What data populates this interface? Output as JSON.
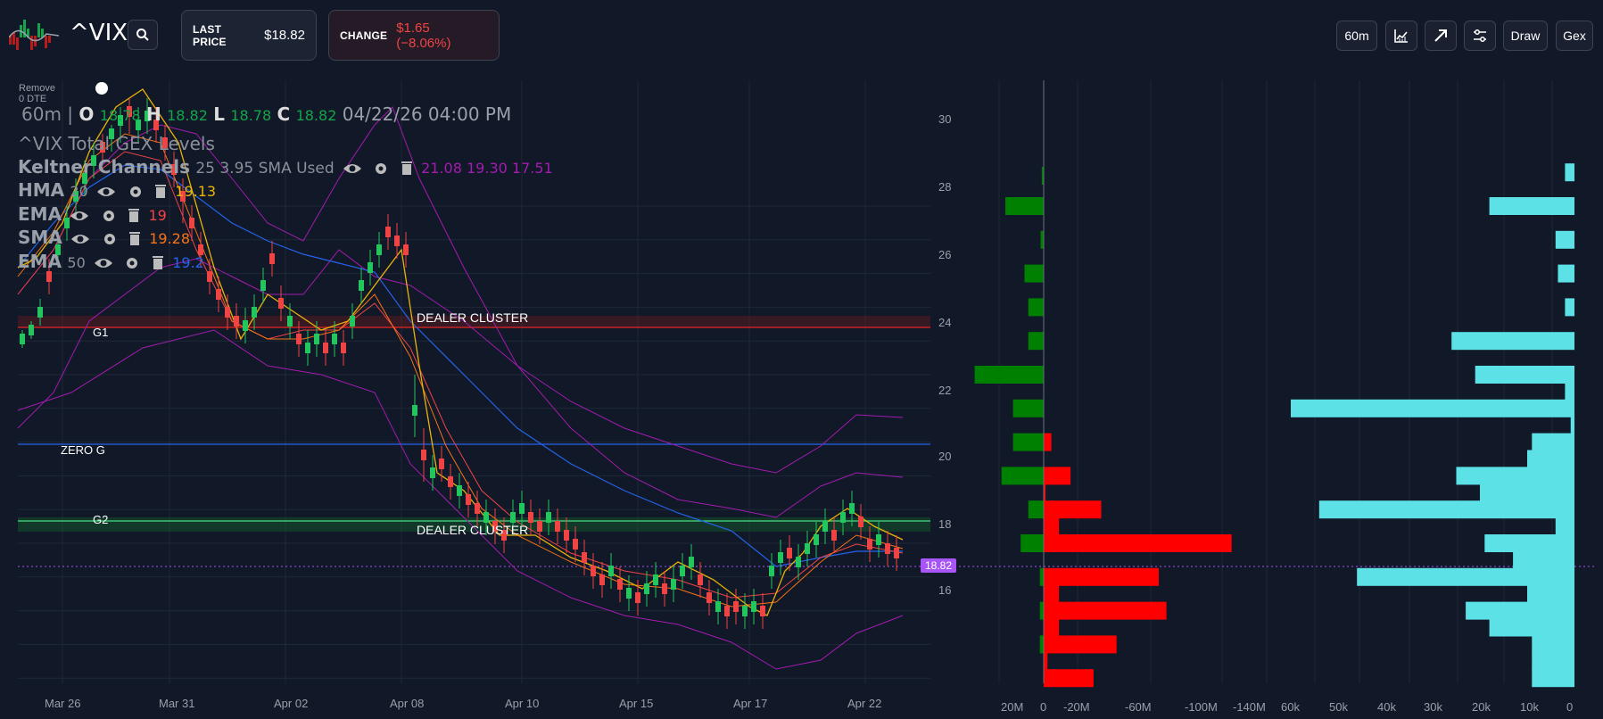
{
  "header": {
    "ticker": "^VIX",
    "last_price_label": "LAST PRICE",
    "last_price_value": "$18.82",
    "change_label": "CHANGE",
    "change_value": "$1.65 (−8.06%)",
    "toolbar": {
      "interval_label": "60m",
      "draw_label": "Draw",
      "gex_label": "Gex"
    }
  },
  "legend": {
    "remove_dte_label": "Remove 0 DTE",
    "ohlc": {
      "interval": "60m",
      "sep": "|",
      "o_label": "O",
      "o_value": "18.78",
      "h_label": "H",
      "h_value": "18.82",
      "l_label": "L",
      "l_value": "18.78",
      "c_label": "C",
      "c_value": "18.82",
      "timestamp": "04/22/26 04:00 PM"
    },
    "gex_title": "^VIX Total GEX Levels",
    "keltner": {
      "name": "Keltner Channels",
      "params": "25 3.95 SMA Used",
      "values": "21.08 19.30 17.51"
    },
    "hma": {
      "name": "HMA",
      "param": "20",
      "value": "19.13"
    },
    "ema1": {
      "name": "EMA",
      "param": "",
      "value": "19"
    },
    "sma": {
      "name": "SMA",
      "param": "",
      "value": "19.28"
    },
    "ema2": {
      "name": "EMA",
      "param": "50",
      "value": "19.2"
    }
  },
  "levels": {
    "g1": "G1",
    "zero_g": "ZERO G",
    "g2": "G2",
    "dealer_cluster_1": "DEALER CLUSTER",
    "dealer_cluster_2": "DEALER CLUSTER"
  },
  "price_tag": "18.82",
  "y_axis": [
    "30",
    "28",
    "26",
    "24",
    "22",
    "20",
    "18",
    "16"
  ],
  "x_axis": [
    "Mar 26",
    "Mar 31",
    "Apr 02",
    "Apr 08",
    "Apr 10",
    "Apr 15",
    "Apr 17",
    "Apr 22"
  ],
  "gex_axis": [
    "20M",
    "0",
    "-20M",
    "-60M",
    "-100M",
    "-140M"
  ],
  "oi_axis": [
    "60k",
    "50k",
    "40k",
    "30k",
    "20k",
    "10k",
    "0"
  ],
  "colors": {
    "bg": "#111827",
    "up": "#22c55e",
    "down": "#ef4444",
    "hma": "#eab308",
    "ema20": "#ef4444",
    "sma": "#f97316",
    "ema50": "#2563eb",
    "keltner": "#a21caf",
    "gex_pos": "#008000",
    "gex_neg": "#ff0000",
    "oi": "#5ce1e6",
    "price_tag": "#a855f7"
  },
  "chart_data": [
    {
      "type": "bar",
      "title": "",
      "categories": [
        "31",
        "30",
        "29",
        "28",
        "27",
        "26",
        "25",
        "24",
        "23",
        "22",
        "21",
        "20",
        "19",
        "18",
        "17",
        "16"
      ],
      "series": [
        {
          "values": [
            0.5,
            10,
            0.8,
            5,
            4,
            4,
            18,
            8,
            8,
            11,
            -7,
            -4,
            -28,
            -7,
            -30,
            -4,
            -18,
            -13
          ]
        }
      ]
    },
    {
      "type": "bar",
      "title": "",
      "categories": [
        "31",
        "30",
        "29",
        "28",
        "27",
        "26",
        "25",
        "24",
        "23",
        "22",
        "21",
        "20",
        "19",
        "18",
        "17",
        "16"
      ],
      "series": [
        {
          "values": [
            2000,
            18000,
            4000,
            3500,
            2000,
            26000,
            21000,
            60000,
            800,
            9000,
            10000,
            25000,
            20000,
            54000,
            4000,
            19000,
            13000,
            46000,
            10000,
            23000,
            18000,
            9000
          ]
        }
      ]
    }
  ]
}
